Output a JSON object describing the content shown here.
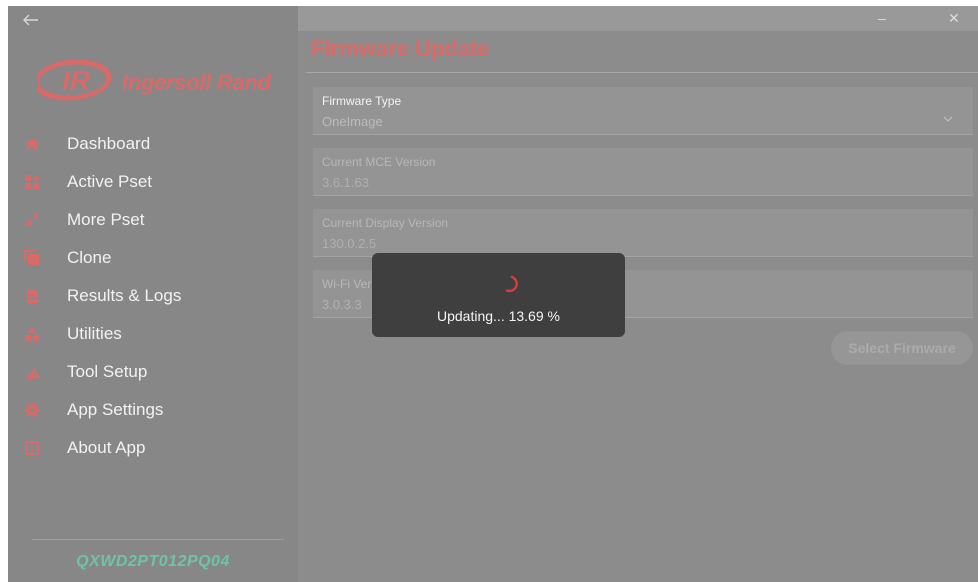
{
  "sidebar": {
    "brand": "Ingersoll Rand",
    "logo_mark": "IR",
    "items": [
      {
        "label": "Dashboard",
        "icon": "home-icon"
      },
      {
        "label": "Active Pset",
        "icon": "active-pset-icon"
      },
      {
        "label": "More Pset",
        "icon": "gears-icon"
      },
      {
        "label": "Clone",
        "icon": "clone-icon"
      },
      {
        "label": "Results & Logs",
        "icon": "document-icon"
      },
      {
        "label": "Utilities",
        "icon": "shapes-icon"
      },
      {
        "label": "Tool Setup",
        "icon": "tool-setup-icon"
      },
      {
        "label": "App Settings",
        "icon": "gear-icon"
      },
      {
        "label": "About App",
        "icon": "info-icon"
      }
    ],
    "serial": "QXWD2PT012PQ04"
  },
  "window": {
    "minimize_glyph": "–",
    "close_glyph": "✕"
  },
  "main": {
    "title": "Firmware Update",
    "fields": {
      "firmware_type": {
        "label": "Firmware Type",
        "value": "OneImage"
      },
      "mce_version": {
        "label": "Current MCE Version",
        "value": "3.6.1.63"
      },
      "display_version": {
        "label": "Current Display Version",
        "value": "130.0.2.5"
      },
      "wifi_version": {
        "label": "Wi-Fi Ver",
        "value": "3.0.3.3"
      }
    },
    "select_firmware_label": "Select Firmware"
  },
  "modal": {
    "progress_text": "Updating... 13.69 %",
    "progress_percent": 13.69
  },
  "colors": {
    "accent": "#d96a6a",
    "serial": "#6fc3a8",
    "spinner": "#e03a3a"
  }
}
